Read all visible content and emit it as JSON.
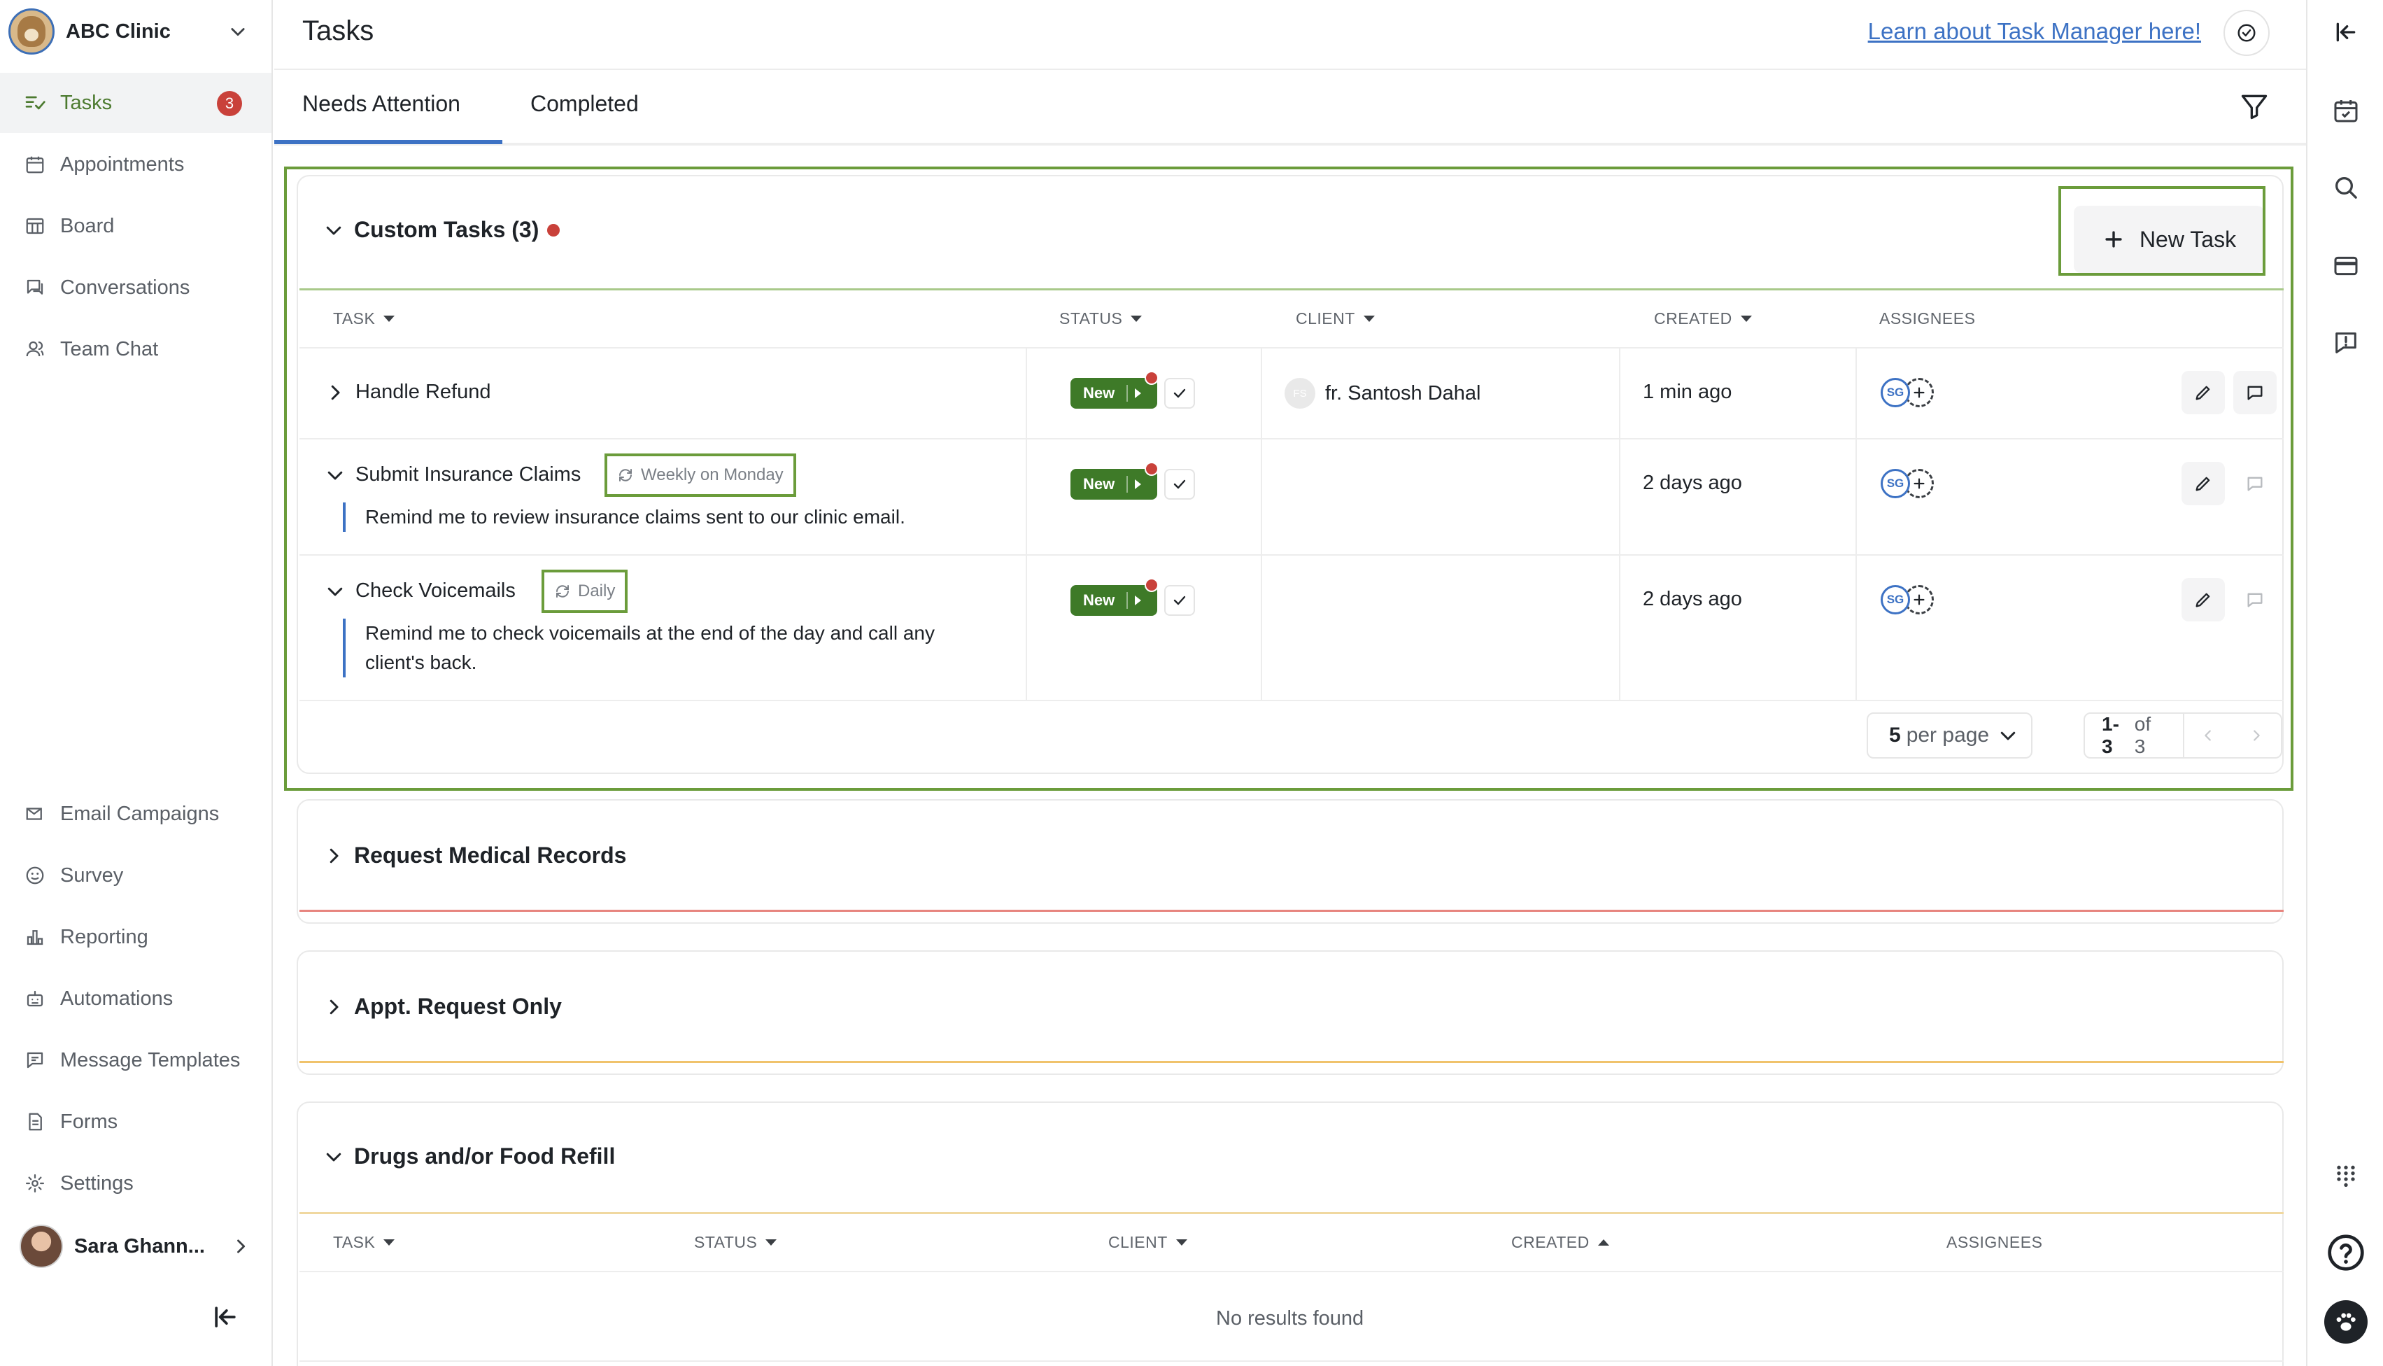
{
  "sidebar": {
    "clinic_name": "ABC Clinic",
    "items_top": [
      {
        "label": "Tasks",
        "icon": "tasks-icon",
        "badge": "3",
        "active": true
      },
      {
        "label": "Appointments",
        "icon": "calendar-icon"
      },
      {
        "label": "Board",
        "icon": "board-icon"
      },
      {
        "label": "Conversations",
        "icon": "conversations-icon"
      },
      {
        "label": "Team Chat",
        "icon": "team-chat-icon"
      }
    ],
    "items_bottom": [
      {
        "label": "Email Campaigns",
        "icon": "email-campaign-icon"
      },
      {
        "label": "Survey",
        "icon": "survey-icon"
      },
      {
        "label": "Reporting",
        "icon": "reporting-icon"
      },
      {
        "label": "Automations",
        "icon": "automations-icon"
      },
      {
        "label": "Message Templates",
        "icon": "message-templates-icon"
      },
      {
        "label": "Forms",
        "icon": "forms-icon"
      },
      {
        "label": "Settings",
        "icon": "settings-icon"
      }
    ],
    "user_name": "Sara Ghann..."
  },
  "header": {
    "title": "Tasks",
    "learn_link": "Learn about Task Manager here!"
  },
  "tabs": [
    {
      "label": "Needs Attention",
      "active": true
    },
    {
      "label": "Completed",
      "active": false
    }
  ],
  "custom_tasks": {
    "title": "Custom Tasks (3)",
    "new_task_label": "New Task",
    "columns": [
      "TASK",
      "STATUS",
      "CLIENT",
      "CREATED",
      "ASSIGNEES"
    ],
    "rows": [
      {
        "task": "Handle Refund",
        "recurrence": "",
        "description": "",
        "status": "New",
        "client_initials": "FS",
        "client": "fr. Santosh Dahal",
        "created": "1 min ago",
        "assignee": "SG"
      },
      {
        "task": "Submit Insurance Claims",
        "recurrence": "Weekly on Monday",
        "description": "Remind me to review insurance claims sent to our clinic email.",
        "status": "New",
        "client_initials": "",
        "client": "",
        "created": "2 days ago",
        "assignee": "SG"
      },
      {
        "task": "Check Voicemails",
        "recurrence": "Daily",
        "description_line1": "Remind me to check voicemails at the end of the day and call any",
        "description_line2": "client's back.",
        "status": "New",
        "client_initials": "",
        "client": "",
        "created": "2 days ago",
        "assignee": "SG"
      }
    ],
    "pager": {
      "per_page_value": "5",
      "per_page_suffix": "per page",
      "range": "1-3",
      "range_suffix": "of 3"
    }
  },
  "sections": [
    {
      "title": "Request Medical Records",
      "accent": "#e7857f"
    },
    {
      "title": "Appt. Request Only",
      "accent": "#f0c36c"
    },
    {
      "title": "Drugs and/or Food Refill",
      "accent": "#f0d8a0"
    }
  ],
  "drugs_table": {
    "columns": [
      "TASK",
      "STATUS",
      "CLIENT",
      "CREATED",
      "ASSIGNEES"
    ],
    "empty_text": "No results found"
  },
  "colors": {
    "brand_green": "#3e7a28",
    "highlight_green": "#6b9c3b",
    "link_blue": "#3d72c4",
    "badge_red": "#c9413a"
  }
}
